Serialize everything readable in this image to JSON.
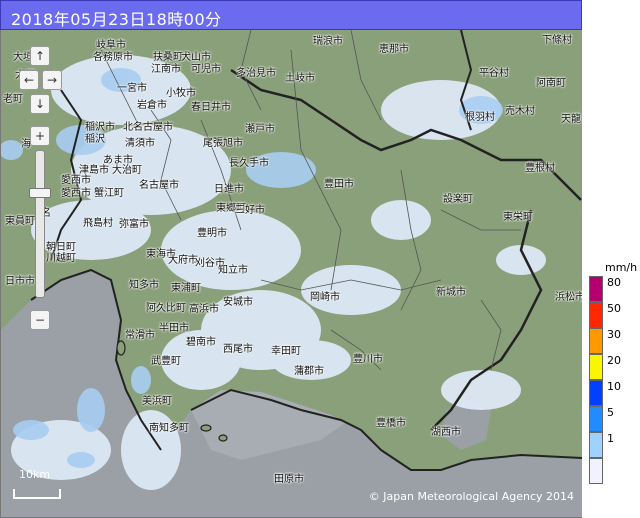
{
  "header": {
    "title": "2018年05月23日18時00分"
  },
  "map": {
    "copyright": "© Japan Meteorological Agency 2014",
    "scale_label": "10km",
    "labels": [
      {
        "text": "瑞浪市"
      },
      {
        "text": "恵那市"
      },
      {
        "text": "下條村"
      },
      {
        "text": "大垣市"
      },
      {
        "text": "岐阜市"
      },
      {
        "text": "各務原市"
      },
      {
        "text": "扶桑町"
      },
      {
        "text": "犬山市"
      },
      {
        "text": "一宮市"
      },
      {
        "text": "江南市"
      },
      {
        "text": "可児市"
      },
      {
        "text": "多治見市"
      },
      {
        "text": "土岐市"
      },
      {
        "text": "岩倉市"
      },
      {
        "text": "小牧市"
      },
      {
        "text": "春日井市"
      },
      {
        "text": "稲沢市"
      },
      {
        "text": "北名古屋市"
      },
      {
        "text": "清須市"
      },
      {
        "text": "あま市"
      },
      {
        "text": "瀬戸市"
      },
      {
        "text": "尾張旭市"
      },
      {
        "text": "長久手市"
      },
      {
        "text": "津島市"
      },
      {
        "text": "大治町"
      },
      {
        "text": "名古屋市"
      },
      {
        "text": "日進市"
      },
      {
        "text": "愛西市"
      },
      {
        "text": "蟹江町"
      },
      {
        "text": "豊田市"
      },
      {
        "text": "東郷町"
      },
      {
        "text": "飛島村"
      },
      {
        "text": "三好市"
      },
      {
        "text": "東員町"
      },
      {
        "text": "東海市"
      },
      {
        "text": "大府市"
      },
      {
        "text": "刈谷市"
      },
      {
        "text": "知立市"
      },
      {
        "text": "豊明市"
      },
      {
        "text": "東浦町"
      },
      {
        "text": "知多市"
      },
      {
        "text": "阿久比町"
      },
      {
        "text": "安城市"
      },
      {
        "text": "高浜市"
      },
      {
        "text": "半田市"
      },
      {
        "text": "碧南市"
      },
      {
        "text": "常滑市"
      },
      {
        "text": "武豊町"
      },
      {
        "text": "西尾市"
      },
      {
        "text": "幸田町"
      },
      {
        "text": "岡崎市"
      },
      {
        "text": "美浜町"
      },
      {
        "text": "南知多町"
      },
      {
        "text": "蒲郡市"
      },
      {
        "text": "豊川市"
      },
      {
        "text": "豊橋市"
      },
      {
        "text": "田原市"
      },
      {
        "text": "湖西市"
      },
      {
        "text": "新城市"
      },
      {
        "text": "設楽町"
      },
      {
        "text": "東栄町"
      },
      {
        "text": "豊根村"
      },
      {
        "text": "根羽村"
      },
      {
        "text": "売木村"
      },
      {
        "text": "平谷村"
      },
      {
        "text": "阿南町"
      },
      {
        "text": "天龍"
      },
      {
        "text": "浜松市"
      },
      {
        "text": "日市市"
      },
      {
        "text": "川越町"
      },
      {
        "text": "朝日町"
      },
      {
        "text": "弥富市"
      },
      {
        "text": "海"
      },
      {
        "text": "名"
      },
      {
        "text": "大垣"
      },
      {
        "text": "老町"
      },
      {
        "text": "愛西市"
      },
      {
        "text": "稲沢"
      }
    ]
  },
  "nav": {
    "up": "↑",
    "down": "↓",
    "left": "←",
    "right": "→",
    "zoom_in": "+",
    "zoom_out": "−"
  },
  "legend": {
    "unit": "mm/h",
    "items": [
      {
        "value": "80",
        "color": "#b4006e"
      },
      {
        "value": "50",
        "color": "#ff2800"
      },
      {
        "value": "30",
        "color": "#ff9900"
      },
      {
        "value": "20",
        "color": "#faf500"
      },
      {
        "value": "10",
        "color": "#0041ff"
      },
      {
        "value": "5",
        "color": "#218cff"
      },
      {
        "value": "1",
        "color": "#a0d2ff"
      },
      {
        "value": "",
        "color": "#f2f2ff"
      }
    ]
  }
}
